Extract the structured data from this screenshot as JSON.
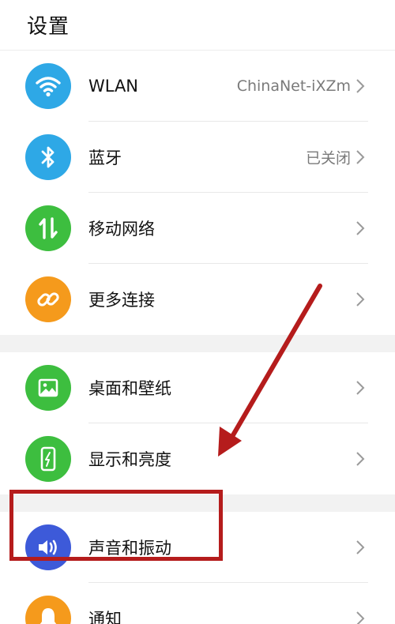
{
  "header": {
    "title": "设置"
  },
  "groups": [
    {
      "items": [
        {
          "label": "WLAN",
          "value": "ChinaNet-iXZm",
          "icon": "wifi-icon",
          "color": "#2ea8e6"
        },
        {
          "label": "蓝牙",
          "value": "已关闭",
          "icon": "bluetooth-icon",
          "color": "#2ea8e6"
        },
        {
          "label": "移动网络",
          "value": "",
          "icon": "mobile-data-icon",
          "color": "#3dbe3f"
        },
        {
          "label": "更多连接",
          "value": "",
          "icon": "link-icon",
          "color": "#f59a1c"
        }
      ]
    },
    {
      "items": [
        {
          "label": "桌面和壁纸",
          "value": "",
          "icon": "wallpaper-icon",
          "color": "#3dbe3f"
        },
        {
          "label": "显示和亮度",
          "value": "",
          "icon": "display-icon",
          "color": "#3dbe3f"
        }
      ]
    },
    {
      "items": [
        {
          "label": "声音和振动",
          "value": "",
          "icon": "sound-icon",
          "color": "#3d5ad9"
        },
        {
          "label": "通知",
          "value": "",
          "icon": "bell-icon",
          "color": "#f59a1c"
        }
      ]
    }
  ],
  "annotation": {
    "color": "#b51c1c"
  }
}
